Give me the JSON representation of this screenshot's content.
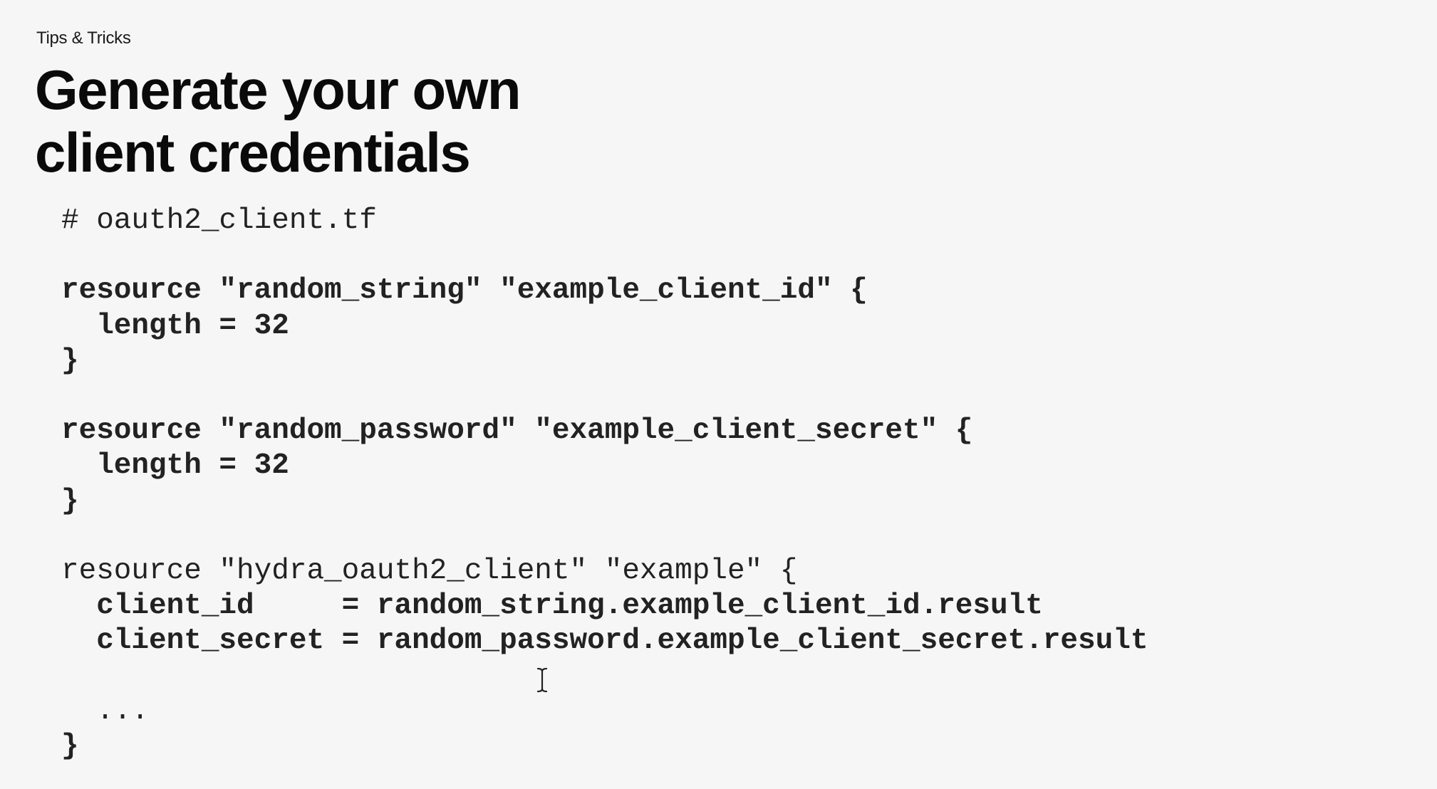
{
  "slide": {
    "eyebrow": "Tips & Tricks",
    "title_line_1": "Generate your own",
    "title_line_2": "client credentials"
  },
  "code": {
    "lines": [
      "# oauth2_client.tf",
      "",
      "resource \"random_string\" \"example_client_id\" {",
      "  length = 32",
      "}",
      "",
      "resource \"random_password\" \"example_client_secret\" {",
      "  length = 32",
      "}",
      "",
      "resource \"hydra_oauth2_client\" \"example\" {",
      "  client_id     = random_string.example_client_id.result",
      "  client_secret = random_password.example_client_secret.result",
      "",
      "  ...",
      "}"
    ]
  },
  "cursor_icon": "text-cursor-icon"
}
